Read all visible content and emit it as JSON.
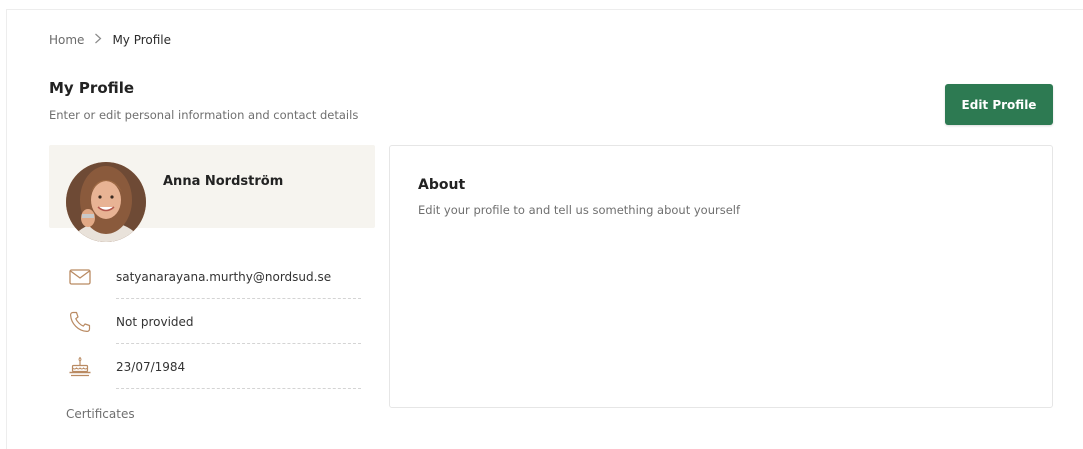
{
  "breadcrumb": {
    "home": "Home",
    "separator": ">",
    "current": "My Profile"
  },
  "header": {
    "title": "My Profile",
    "subtitle": "Enter or edit personal information and contact details",
    "edit_button": "Edit Profile"
  },
  "profile": {
    "name": "Anna Nordström",
    "email": "satyanarayana.murthy@nordsud.se",
    "phone": "Not provided",
    "birthdate": "23/07/1984",
    "certificates_label": "Certificates"
  },
  "about": {
    "title": "About",
    "text": "Edit your profile to and tell us something about yourself"
  },
  "icons": {
    "email": "envelope-icon",
    "phone": "phone-icon",
    "birthdate": "birthday-cake-icon"
  },
  "colors": {
    "accent": "#2d7a52",
    "icon": "#b98a62",
    "card_bg": "#f6f4ef"
  }
}
